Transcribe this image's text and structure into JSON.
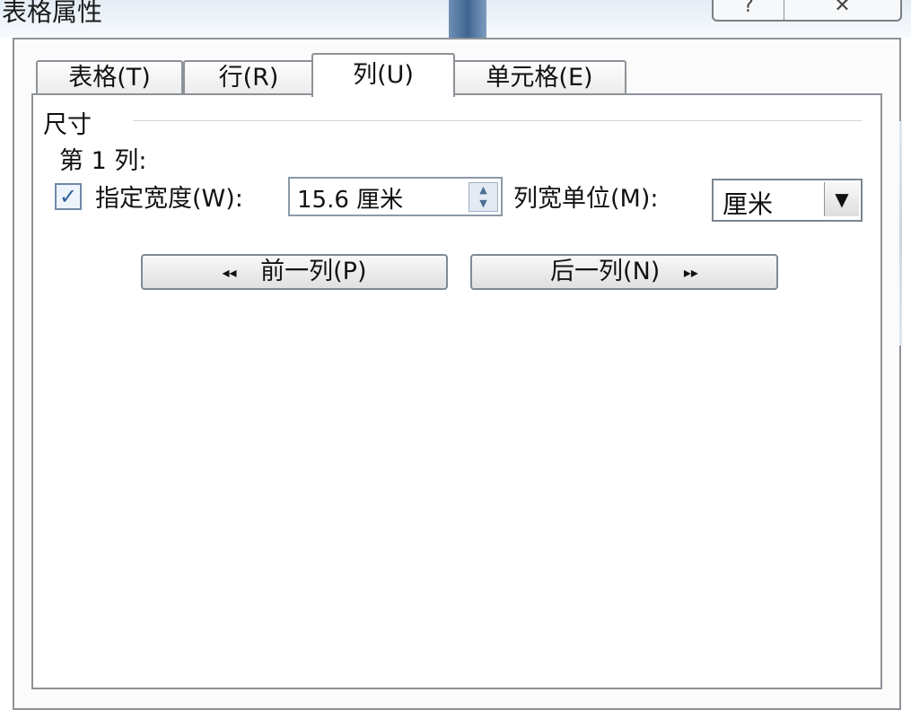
{
  "window": {
    "title": "表格属性",
    "help_icon": "help-icon",
    "close_icon": "close-icon",
    "help_glyph": "?",
    "close_glyph": "✕"
  },
  "tabs": [
    {
      "label": "表格(T)",
      "active": false
    },
    {
      "label": "行(R)",
      "active": false
    },
    {
      "label": "列(U)",
      "active": true
    },
    {
      "label": "单元格(E)",
      "active": false
    }
  ],
  "panel": {
    "size_label": "尺寸",
    "column_label": "第 1 列:",
    "specify_width": {
      "label": "指定宽度(W):",
      "checked": true,
      "check_glyph": "✓"
    },
    "width_input": {
      "value": "15.6 厘米"
    },
    "unit": {
      "label": "列宽单位(M):",
      "selected": "厘米"
    },
    "prev_button": {
      "label": "前一列(P)",
      "arrows": "◂◂"
    },
    "next_button": {
      "label": "后一列(N)",
      "arrows": "▸▸"
    }
  },
  "colors": {
    "accent": "#3f6692",
    "border": "#8d9298"
  }
}
